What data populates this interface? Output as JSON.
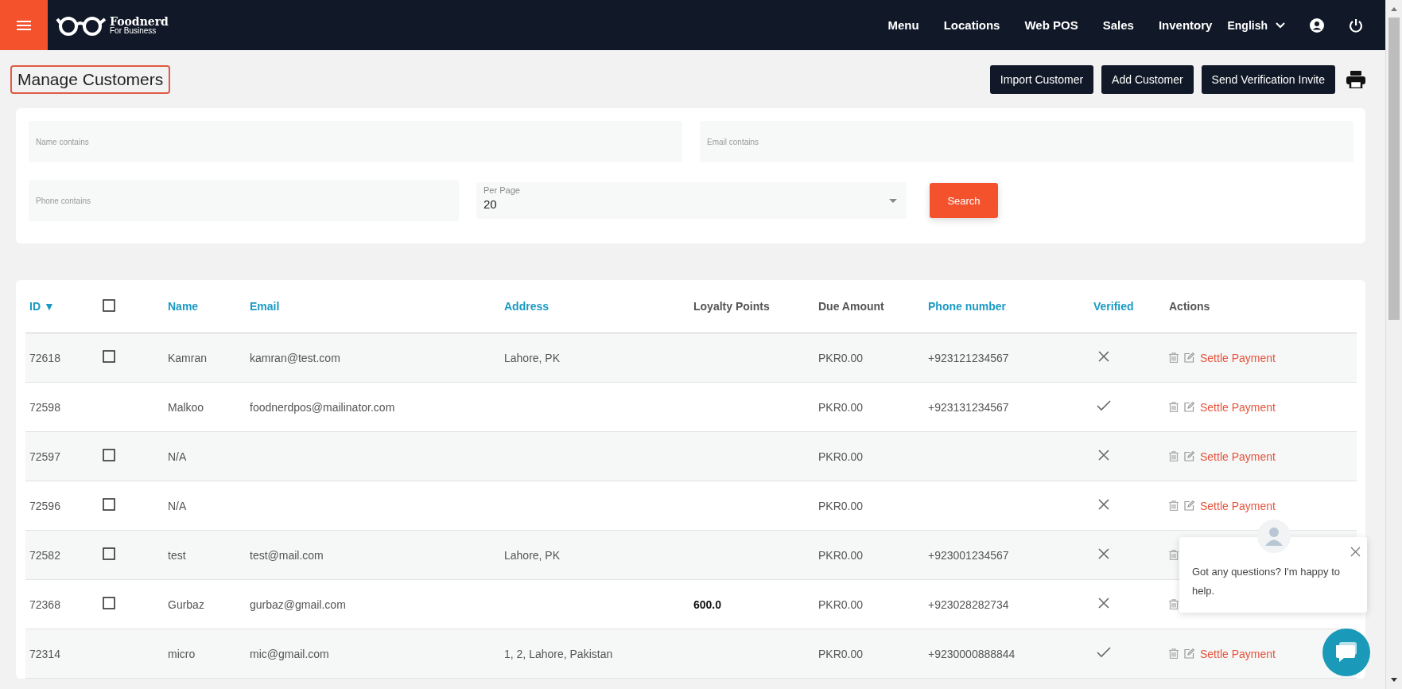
{
  "navbar": {
    "brand": {
      "name": "Foodnerd",
      "tagline": "For Business"
    },
    "links": [
      {
        "label": "Menu"
      },
      {
        "label": "Locations"
      },
      {
        "label": "Web POS"
      },
      {
        "label": "Sales"
      },
      {
        "label": "Inventory"
      }
    ],
    "language": "English"
  },
  "page": {
    "title": "Manage Customers",
    "buttons": [
      "Import Customer",
      "Add Customer",
      "Send Verification Invite"
    ]
  },
  "filters": {
    "name": {
      "placeholder": "Name contains"
    },
    "email": {
      "placeholder": "Email contains"
    },
    "phone": {
      "placeholder": "Phone contains"
    },
    "per_page": {
      "label": "Per Page",
      "value": "20"
    },
    "search_button": "Search"
  },
  "table": {
    "columns": [
      {
        "label": "ID",
        "kind": "sort",
        "sort_icon": "▼"
      },
      {
        "kind": "checkbox",
        "checked": false
      },
      {
        "label": "Name",
        "kind": "link"
      },
      {
        "label": "Email",
        "kind": "link"
      },
      {
        "label": "Address",
        "kind": "link"
      },
      {
        "label": "Loyalty Points",
        "kind": "plain"
      },
      {
        "label": "Due Amount",
        "kind": "plain"
      },
      {
        "label": "Phone number",
        "kind": "link"
      },
      {
        "label": "Verified",
        "kind": "link"
      },
      {
        "label": "Actions",
        "kind": "plain"
      }
    ],
    "rows": [
      {
        "id": "72618",
        "checked": false,
        "name": "Kamran",
        "email": "kamran@test.com",
        "address": "Lahore, PK",
        "loyalty_points": "",
        "due_amount": "PKR0.00",
        "phone": "+923121234567",
        "verified": false,
        "action": "Settle Payment"
      },
      {
        "id": "72598",
        "name": "Malkoo",
        "email": "foodnerdpos@mailinator.com",
        "address": "",
        "loyalty_points": "",
        "due_amount": "PKR0.00",
        "phone": "+923131234567",
        "verified": true,
        "action": "Settle Payment"
      },
      {
        "id": "72597",
        "checked": false,
        "name": "N/A",
        "email": "",
        "address": "",
        "loyalty_points": "",
        "due_amount": "PKR0.00",
        "phone": "",
        "verified": false,
        "action": "Settle Payment"
      },
      {
        "id": "72596",
        "checked": false,
        "name": "N/A",
        "email": "",
        "address": "",
        "loyalty_points": "",
        "due_amount": "PKR0.00",
        "phone": "",
        "verified": false,
        "action": "Settle Payment"
      },
      {
        "id": "72582",
        "checked": false,
        "name": "test",
        "email": "test@mail.com",
        "address": "Lahore, PK",
        "loyalty_points": "",
        "due_amount": "PKR0.00",
        "phone": "+923001234567",
        "verified": false,
        "action": ""
      },
      {
        "id": "72368",
        "checked": false,
        "name": "Gurbaz",
        "email": "gurbaz@gmail.com",
        "address": "",
        "loyalty_points": "600.0",
        "due_amount": "PKR0.00",
        "phone": "+923028282734",
        "verified": false,
        "action": ""
      },
      {
        "id": "72314",
        "name": "micro",
        "email": "mic@gmail.com",
        "address": "1, 2, Lahore, Pakistan",
        "loyalty_points": "",
        "due_amount": "PKR0.00",
        "phone": "+9230000888844",
        "verified": true,
        "action": "Settle Payment"
      }
    ]
  },
  "chat": {
    "message": "Got any questions? I'm happy to help."
  }
}
